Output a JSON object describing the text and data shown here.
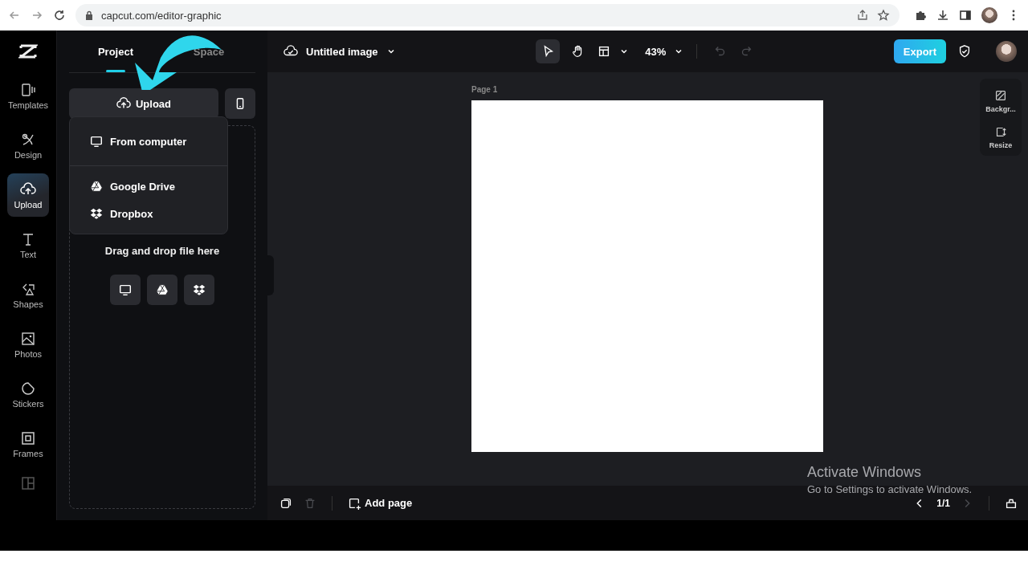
{
  "browser": {
    "url": "capcut.com/editor-graphic"
  },
  "rail": [
    {
      "label": "Templates",
      "selected": false
    },
    {
      "label": "Design",
      "selected": false
    },
    {
      "label": "Upload",
      "selected": true
    },
    {
      "label": "Text",
      "selected": false
    },
    {
      "label": "Shapes",
      "selected": false
    },
    {
      "label": "Photos",
      "selected": false
    },
    {
      "label": "Stickers",
      "selected": false
    },
    {
      "label": "Frames",
      "selected": false
    }
  ],
  "panel": {
    "tabs": [
      {
        "label": "Project",
        "selected": true
      },
      {
        "label": "Space",
        "selected": false
      }
    ],
    "upload_button": "Upload",
    "menu": [
      {
        "label": "From computer"
      },
      {
        "label": "Google Drive"
      },
      {
        "label": "Dropbox"
      }
    ],
    "drop_hint": "Drag and drop file here"
  },
  "header": {
    "title": "Untitled image",
    "zoom": "43%",
    "undo_disabled": true,
    "redo_disabled": true,
    "export": "Export"
  },
  "canvas": {
    "page_label": "Page 1"
  },
  "side_tools": [
    {
      "label": "Backgr..."
    },
    {
      "label": "Resize"
    }
  ],
  "bottom": {
    "add_page": "Add page",
    "page_count": "1/1"
  },
  "watermark": {
    "title": "Activate Windows",
    "subtitle": "Go to Settings to activate Windows."
  }
}
